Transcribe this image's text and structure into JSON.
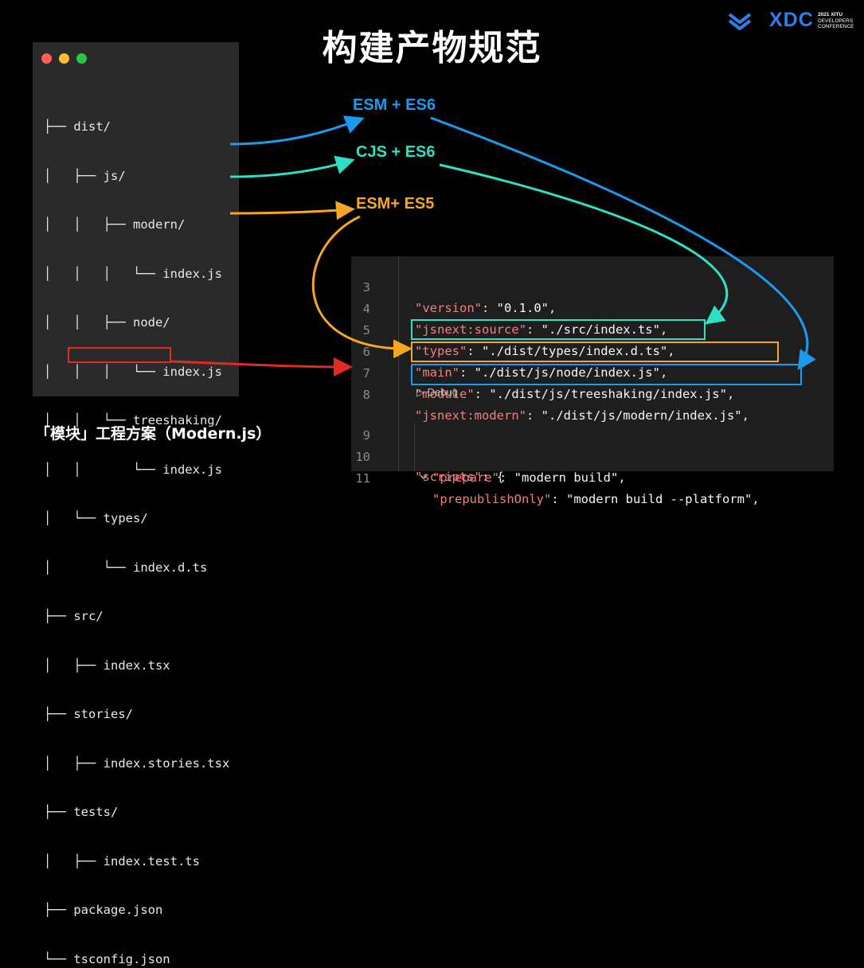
{
  "slide": {
    "title": "构建产物规范",
    "caption": "「模块」工程方案（Modern.js）"
  },
  "logo": {
    "brand": "XDC",
    "line1": "2021 XITU",
    "line2": "DEVELOPERS",
    "line3": "CONFERENCE",
    "accent": "#2f7fe8"
  },
  "window": {
    "controls": [
      "close",
      "minimize",
      "maximize"
    ]
  },
  "file_tree": {
    "lines": [
      "├── dist/",
      "│   ├── js/",
      "│   │   ├── modern/",
      "│   │   │   └── index.js",
      "│   │   ├── node/",
      "│   │   │   └── index.js",
      "│   │   └── treeshaking/",
      "│   │       └── index.js",
      "│   └── types/",
      "│       └── index.d.ts",
      "├── src/",
      "│   ├── index.tsx",
      "├── stories/",
      "│   ├── index.stories.tsx",
      "├── tests/",
      "│   ├── index.test.ts",
      "├── package.json",
      "└── tsconfig.json"
    ],
    "highlight": "package.json"
  },
  "labels": {
    "esm_es6": "ESM + ES6",
    "cjs_es6": "CJS + ES6",
    "esm_es5": "ESM+ ES5"
  },
  "colors": {
    "blue": "#1a9bf0",
    "teal": "#2ee0c4",
    "orange": "#f5a623",
    "red": "#e02b20",
    "key": "#f47f83"
  },
  "code": {
    "lines": [
      {
        "num": "3",
        "key": "\"version\"",
        "value": "\"0.1.0\""
      },
      {
        "num": "4",
        "key": "\"jsnext:source\"",
        "value": "\"./src/index.ts\""
      },
      {
        "num": "5",
        "key": "\"types\"",
        "value": "\"./dist/types/index.d.ts\""
      },
      {
        "num": "6",
        "key": "\"main\"",
        "value": "\"./dist/js/node/index.js\""
      },
      {
        "num": "7",
        "key": "\"module\"",
        "value": "\"./dist/js/treeshaking/index.js\""
      },
      {
        "num": "8",
        "key": "\"jsnext:modern\"",
        "value": "\"./dist/js/modern/index.js\""
      },
      {
        "num": "9",
        "key": "\"scripts\"",
        "value": "{"
      },
      {
        "num": "10",
        "key": "\"prepare\"",
        "value": "\"modern build\""
      },
      {
        "num": "11",
        "key": "\"prepublishOnly\"",
        "value": "\"modern build --platform\""
      }
    ],
    "codelens": "▷ Debug",
    "fold_icon": "chevron-down-icon"
  }
}
